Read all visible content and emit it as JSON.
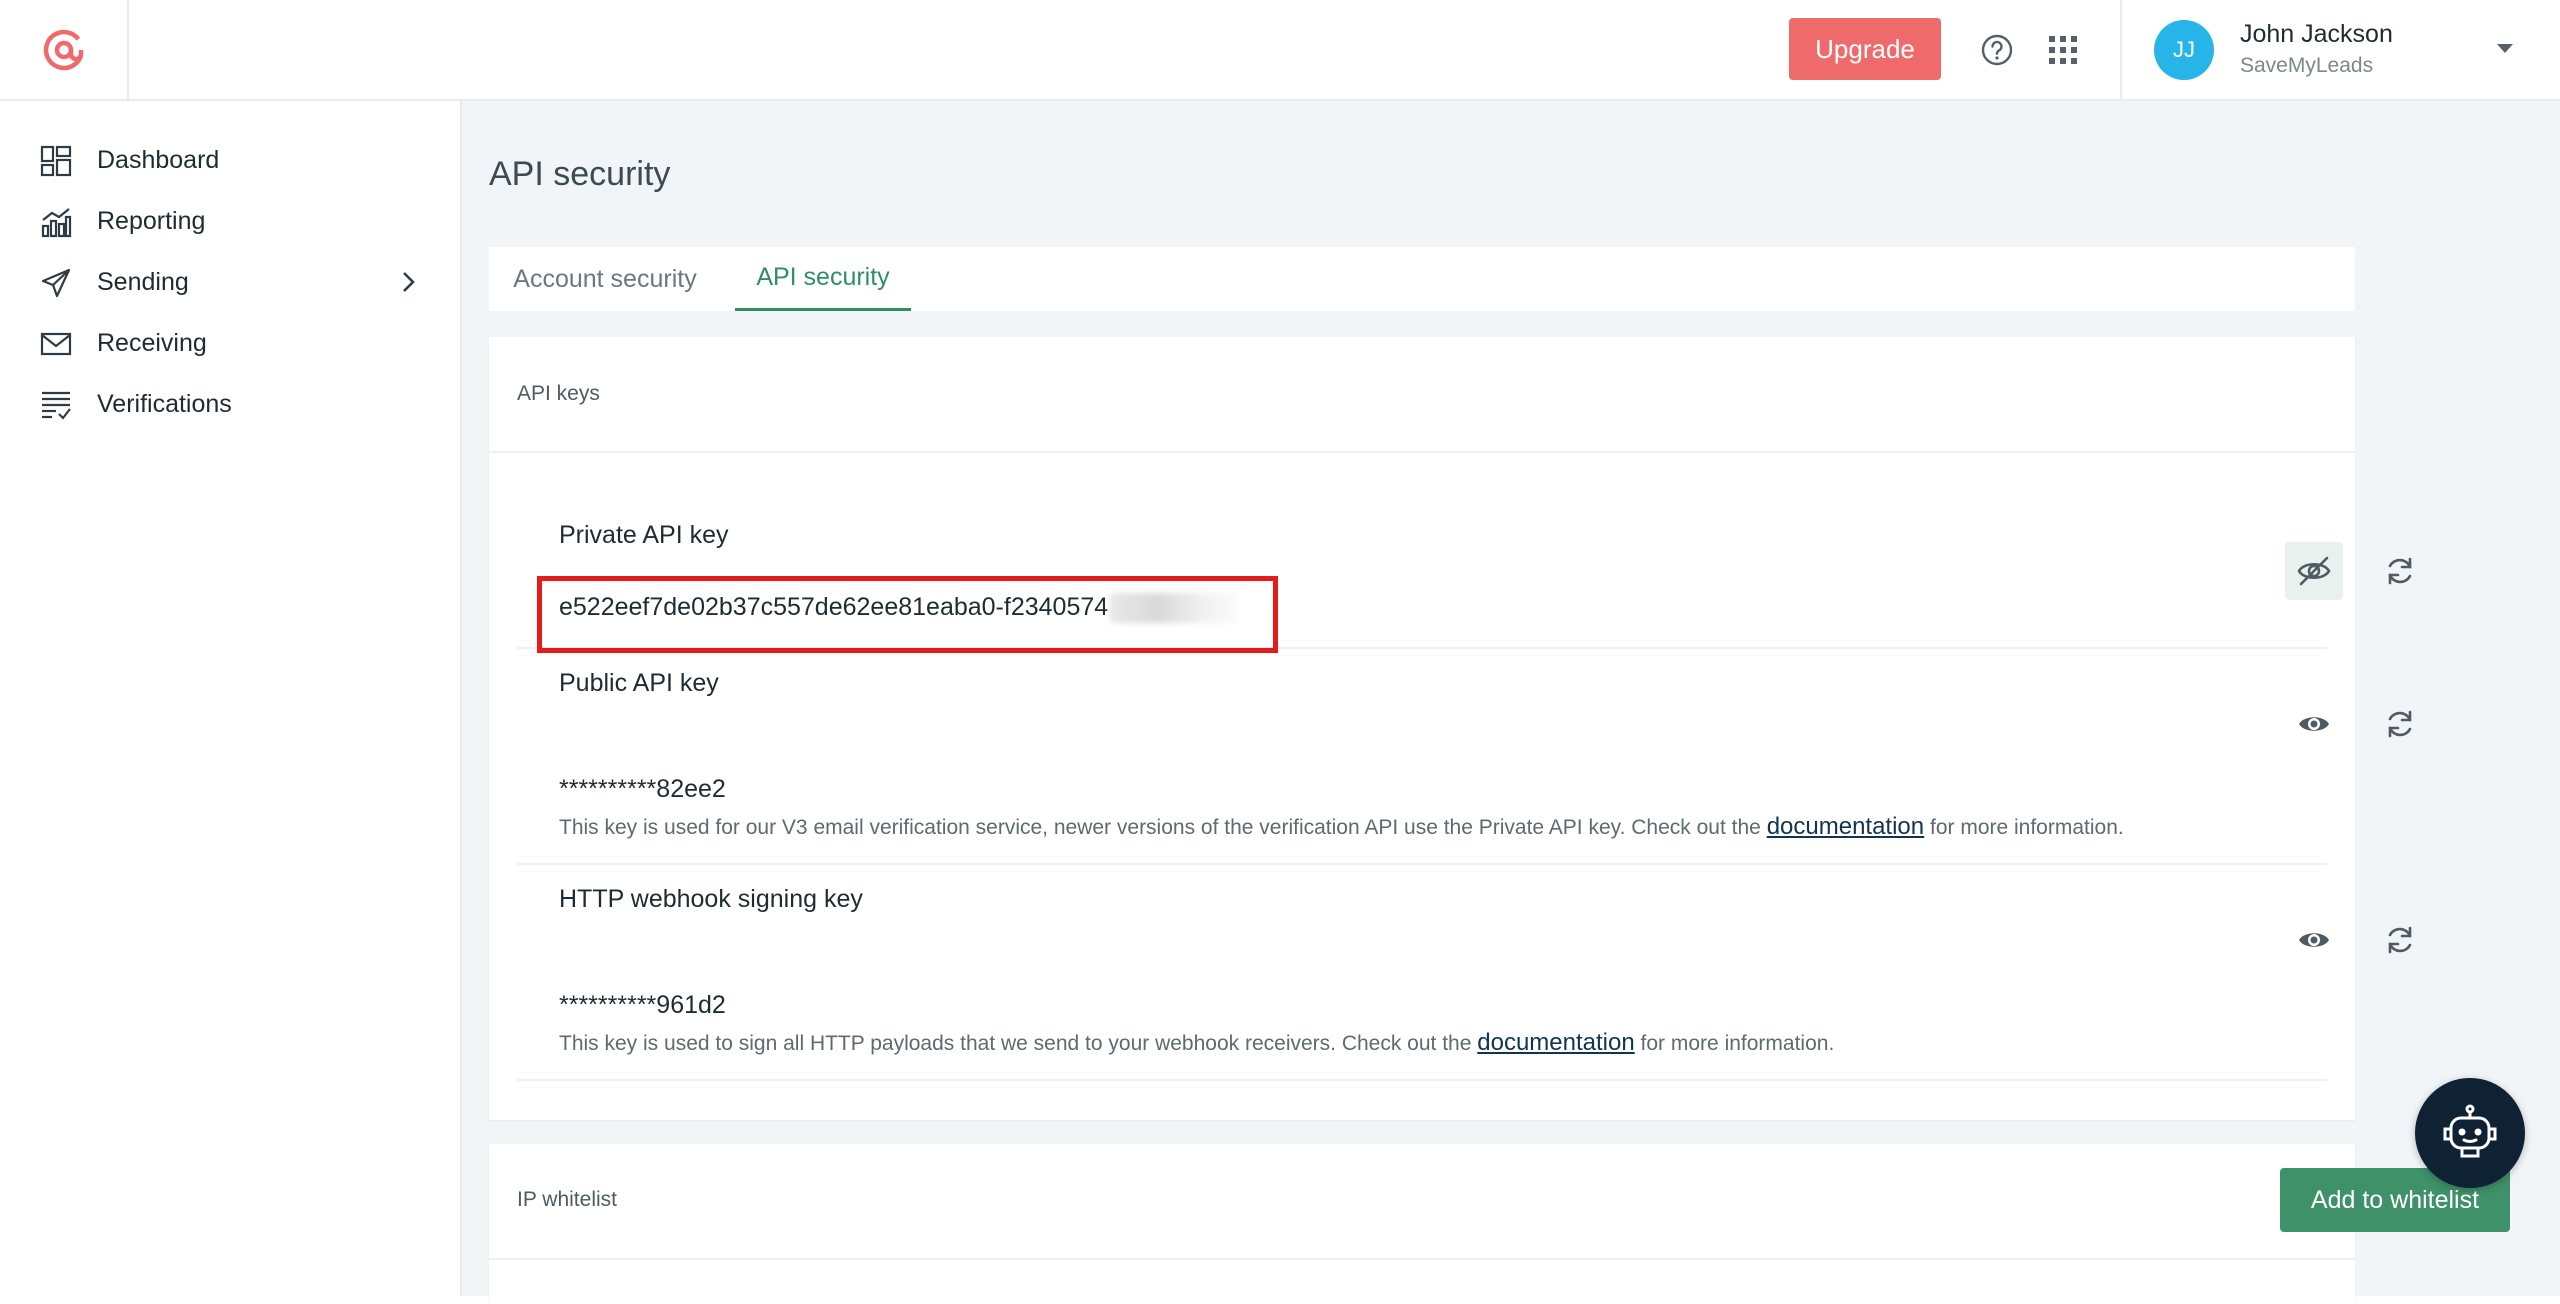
{
  "header": {
    "logo_icon": "at-sign-logo",
    "upgrade_label": "Upgrade",
    "help_icon": "question-circle-icon",
    "apps_icon": "apps-grid-icon",
    "user": {
      "initials": "JJ",
      "name": "John Jackson",
      "org": "SaveMyLeads",
      "avatar_color": "#27b4e9"
    }
  },
  "sidebar": {
    "items": [
      {
        "label": "Dashboard",
        "icon": "dashboard-icon"
      },
      {
        "label": "Reporting",
        "icon": "chart-icon"
      },
      {
        "label": "Sending",
        "icon": "paper-plane-icon",
        "has_submenu": true
      },
      {
        "label": "Receiving",
        "icon": "envelope-icon"
      },
      {
        "label": "Verifications",
        "icon": "checklist-icon"
      }
    ]
  },
  "main": {
    "page_title": "API security",
    "tabs": [
      {
        "label": "Account security",
        "active": false
      },
      {
        "label": "API security",
        "active": true
      }
    ],
    "api_keys": {
      "section_title": "API keys",
      "keys": [
        {
          "name": "Private API key",
          "value": "e522eef7de02b37c557de62ee81eaba0-f2340574",
          "revealed": true,
          "description": ""
        },
        {
          "name": "Public API key",
          "value": "**********82ee2",
          "revealed": false,
          "description_before": "This key is used for our V3 email verification service, newer versions of the verification API use the Private API key. Check out the",
          "link": "documentation",
          "description_after": "for more information."
        },
        {
          "name": "HTTP webhook signing key",
          "value": "**********961d2",
          "revealed": false,
          "description_before": "This key is used to sign all HTTP payloads that we send to your webhook receivers. Check out the",
          "link": "documentation",
          "description_after": "for more information."
        }
      ]
    },
    "ip_whitelist": {
      "section_title": "IP whitelist",
      "add_label": "Add to whitelist"
    }
  },
  "colors": {
    "accent": "#2e8f63",
    "upgrade": "#ef6b6b",
    "highlight": "#e41c1c",
    "chatbot": "#0f2233"
  }
}
